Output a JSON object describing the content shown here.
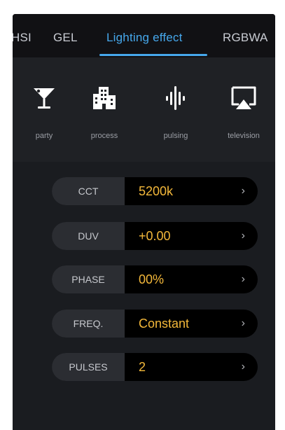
{
  "tabs": [
    {
      "label": "HSI"
    },
    {
      "label": "GEL"
    },
    {
      "label": "Lighting effect"
    },
    {
      "label": "RGBWA"
    }
  ],
  "active_tab": "Lighting effect",
  "effects": [
    {
      "label": "party",
      "icon": "cocktail-glass-icon"
    },
    {
      "label": "process",
      "icon": "building-icon"
    },
    {
      "label": "pulsing",
      "icon": "pulse-bars-icon"
    },
    {
      "label": "television",
      "icon": "tv-icon"
    }
  ],
  "params": [
    {
      "name": "CCT",
      "value": "5200k"
    },
    {
      "name": "DUV",
      "value": "+0.00"
    },
    {
      "name": "PHASE",
      "value": "00%"
    },
    {
      "name": "FREQ.",
      "value": "Constant"
    },
    {
      "name": "PULSES",
      "value": "2"
    }
  ],
  "colors": {
    "accent": "#46a8ec",
    "value": "#f4b83a",
    "background": "#0d0d0f"
  }
}
